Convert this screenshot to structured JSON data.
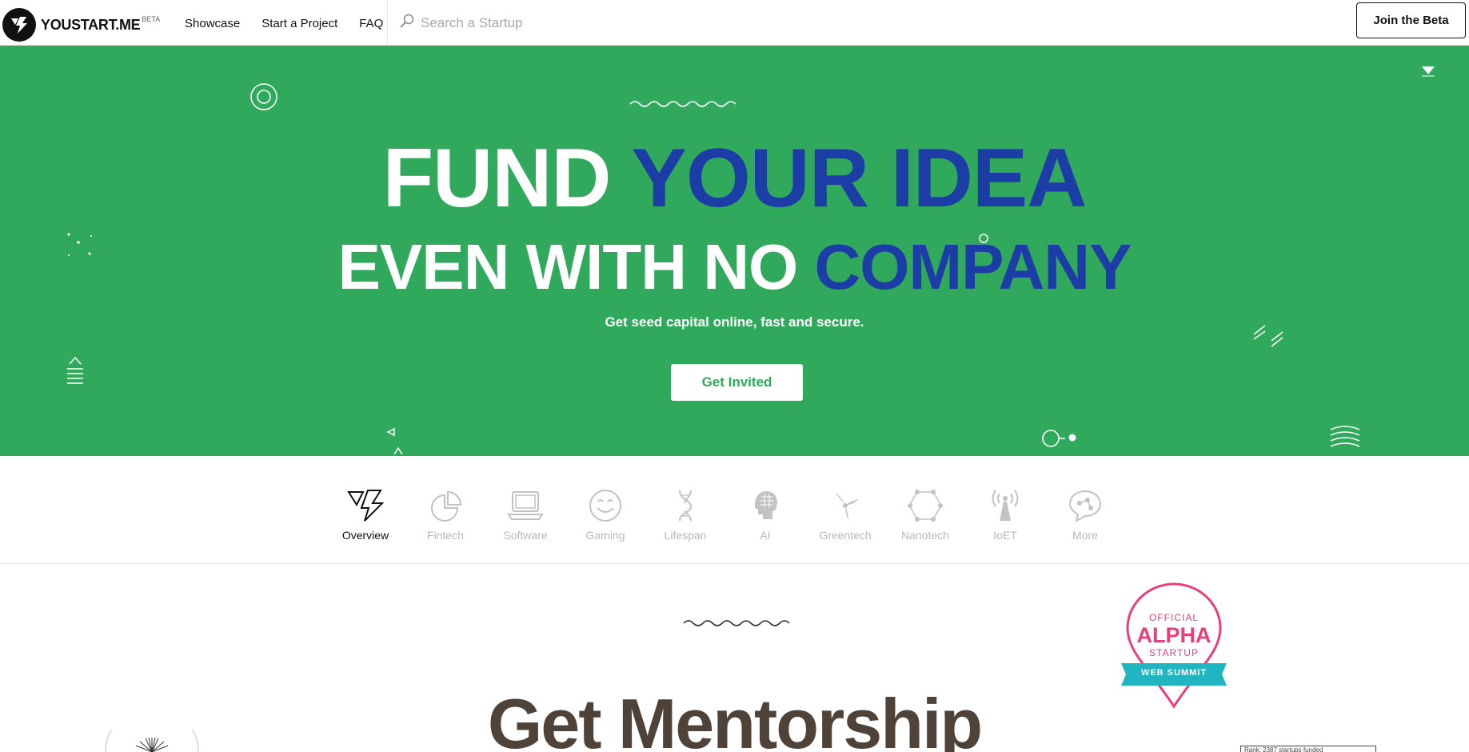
{
  "header": {
    "logo_text": "YOUSTART.ME",
    "logo_badge": "BETA",
    "nav": [
      {
        "label": "Showcase"
      },
      {
        "label": "Start a Project"
      },
      {
        "label": "FAQ"
      }
    ],
    "search_placeholder": "Search a Startup",
    "join_label": "Join the Beta"
  },
  "hero": {
    "line1_white": "FUND ",
    "line1_blue": "YOUR IDEA",
    "line2_white": "EVEN WITH NO ",
    "line2_blue": "COMPANY",
    "subtitle": "Get seed capital online, fast and secure.",
    "cta_label": "Get Invited",
    "colors": {
      "background": "#31a95d",
      "accent": "#1c3ca6",
      "text": "#ffffff"
    }
  },
  "categories": {
    "active": "Overview",
    "items": [
      {
        "label": "Overview",
        "icon": "lightning-icon"
      },
      {
        "label": "Fintech",
        "icon": "pie-chart-icon"
      },
      {
        "label": "Software",
        "icon": "laptop-icon"
      },
      {
        "label": "Gaming",
        "icon": "smiley-icon"
      },
      {
        "label": "Lifespan",
        "icon": "dna-icon"
      },
      {
        "label": "AI",
        "icon": "robot-head-icon"
      },
      {
        "label": "Greentech",
        "icon": "turbine-icon"
      },
      {
        "label": "Nanotech",
        "icon": "hexagon-molecule-icon"
      },
      {
        "label": "IoET",
        "icon": "antenna-icon"
      },
      {
        "label": "More",
        "icon": "chat-bubble-icon"
      }
    ]
  },
  "mentorship": {
    "heading": "Get Mentorship"
  },
  "badge": {
    "top": "OFFICIAL",
    "middle": "ALPHA",
    "bottom": "STARTUP",
    "ribbon": "WEB SUMMIT",
    "color": "#e8417a",
    "ribbon_color": "#1fb5c1"
  },
  "mini_box_text": "Rank: 2387 startups funded"
}
